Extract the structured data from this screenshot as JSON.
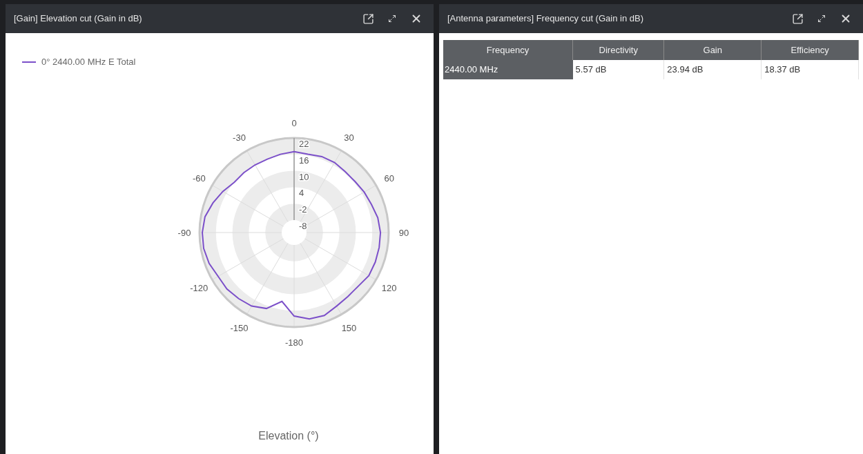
{
  "left_panel": {
    "title": "[Gain] Elevation cut (Gain in dB)",
    "polar_plot": {
      "legend": [
        {
          "label": "0° 2440.00 MHz E Total",
          "color": "#7b4fc9"
        }
      ],
      "angle_labels": [
        "0",
        "30",
        "60",
        "90",
        "120",
        "150",
        "-180",
        "-150",
        "-120",
        "-90",
        "-60",
        "-30"
      ],
      "radius_labels": [
        "22",
        "16",
        "10",
        "4",
        "-2",
        "-8"
      ],
      "axis_title": "Elevation (°)"
    }
  },
  "right_panel": {
    "title": "[Antenna parameters] Frequency cut (Gain in dB)",
    "table": {
      "columns": [
        "Frequency",
        "Directivity",
        "Gain",
        "Efficiency"
      ],
      "rows": [
        [
          "2440.00 MHz",
          "5.57 dB",
          "23.94 dB",
          "18.37 dB"
        ]
      ]
    }
  }
}
